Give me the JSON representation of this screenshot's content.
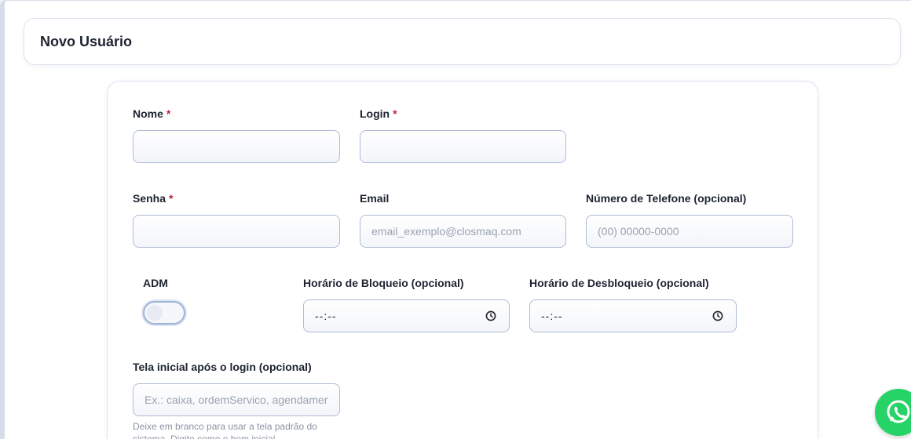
{
  "page": {
    "title": "Novo Usuário"
  },
  "form": {
    "nome": {
      "label": "Nome",
      "required_mark": "*",
      "value": ""
    },
    "login": {
      "label": "Login",
      "required_mark": "*",
      "value": ""
    },
    "senha": {
      "label": "Senha",
      "required_mark": "*",
      "value": ""
    },
    "email": {
      "label": "Email",
      "placeholder": "email_exemplo@closmaq.com",
      "value": ""
    },
    "telefone": {
      "label": "Número de Telefone (opcional)",
      "placeholder": "(00) 00000-0000",
      "value": ""
    },
    "adm": {
      "label": "ADM",
      "checked": false
    },
    "bloqueio": {
      "label": "Horário de Bloqueio (opcional)",
      "value": "--:--",
      "icon": "clock-icon"
    },
    "desbloqueio": {
      "label": "Horário de Desbloqueio (opcional)",
      "value": "--:--",
      "icon": "clock-icon"
    },
    "tela_inicial": {
      "label": "Tela inicial após o login (opcional)",
      "placeholder": "Ex.: caixa, ordemServico, agendamento",
      "help": "Deixe em branco para usar a tela padrão do sistema. Digite como o bem inicial."
    }
  },
  "floating": {
    "whatsapp_icon": "whatsapp-icon",
    "color": "#25d366"
  }
}
